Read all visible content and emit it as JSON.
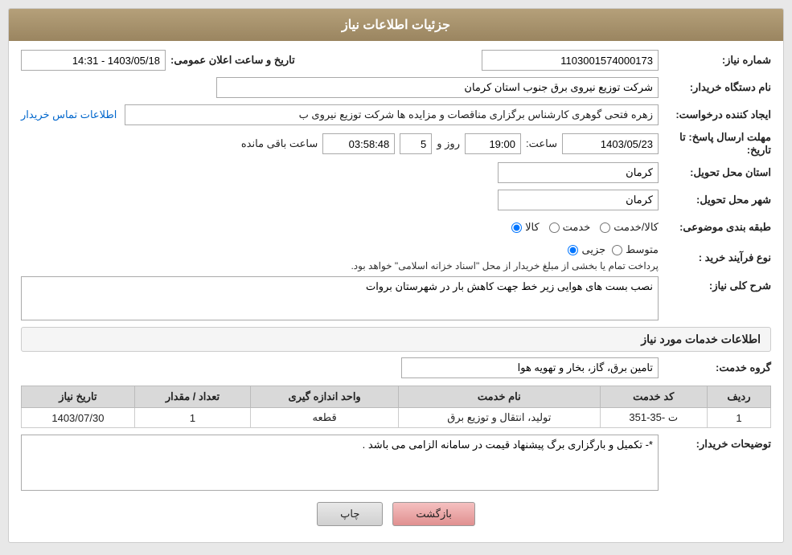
{
  "header": {
    "title": "جزئیات اطلاعات نیاز"
  },
  "fields": {
    "shomara_niaz_label": "شماره نیاز:",
    "shomara_niaz_value": "1103001574000173",
    "tarikh_label": "تاریخ و ساعت اعلان عمومی:",
    "tarikh_value": "1403/05/18 - 14:31",
    "nam_dastgah_label": "نام دستگاه خریدار:",
    "nam_dastgah_value": "شرکت توزیع نیروی برق جنوب استان کرمان",
    "ijad_label": "ایجاد کننده درخواست:",
    "ijad_value": "زهره فتحی گوهری کارشناس برگزاری مناقصات و مزایده ها شرکت توزیع نیروی ب",
    "ettelaat_tamas_label": "اطلاعات تماس خریدار",
    "mohlat_label": "مهلت ارسال پاسخ: تا تاریخ:",
    "mohlat_date": "1403/05/23",
    "mohlat_saat_label": "ساعت:",
    "mohlat_saat": "19:00",
    "mohlat_roz_label": "روز و",
    "mohlat_roz": "5",
    "mohlat_baqi_label": "ساعت باقی مانده",
    "mohlat_baqi": "03:58:48",
    "ostan_tahvil_label": "استان محل تحویل:",
    "ostan_tahvil_value": "کرمان",
    "shahr_tahvil_label": "شهر محل تحویل:",
    "shahr_tahvil_value": "کرمان",
    "tabaqe_label": "طبقه بندی موضوعی:",
    "tabaqe_kala_label": "کالا",
    "tabaqe_khedmat_label": "خدمت",
    "tabaqe_kala_khedmat_label": "کالا/خدمت",
    "nooe_farayand_label": "نوع فرآیند خرید :",
    "nooe_jozyi_label": "جزیی",
    "nooe_motavasset_label": "متوسط",
    "nooe_description": "پرداخت تمام یا بخشی از مبلغ خریدار از محل \"اسناد خزانه اسلامی\" خواهد بود.",
    "sharh_label": "شرح کلی نیاز:",
    "sharh_value": "نصب بست های هوایی زیر خط جهت کاهش بار در شهرستان بروات",
    "services_header": "اطلاعات خدمات مورد نیاز",
    "group_khedmat_label": "گروه خدمت:",
    "group_khedmat_value": "تامین برق، گاز، بخار و تهویه هوا",
    "table": {
      "headers": [
        "ردیف",
        "کد خدمت",
        "نام خدمت",
        "واحد اندازه گیری",
        "تعداد / مقدار",
        "تاریخ نیاز"
      ],
      "rows": [
        {
          "radif": "1",
          "kod": "ت -35-351",
          "nam": "تولید، انتقال و توزیع برق",
          "vahed": "قطعه",
          "tedad": "1",
          "tarikh": "1403/07/30"
        }
      ]
    },
    "tosihaat_label": "توضیحات خریدار:",
    "tosihaat_value": "*- تکمیل و بارگزاری برگ پیشنهاد قیمت در سامانه الزامی می باشد ."
  },
  "buttons": {
    "print_label": "چاپ",
    "back_label": "بازگشت"
  }
}
